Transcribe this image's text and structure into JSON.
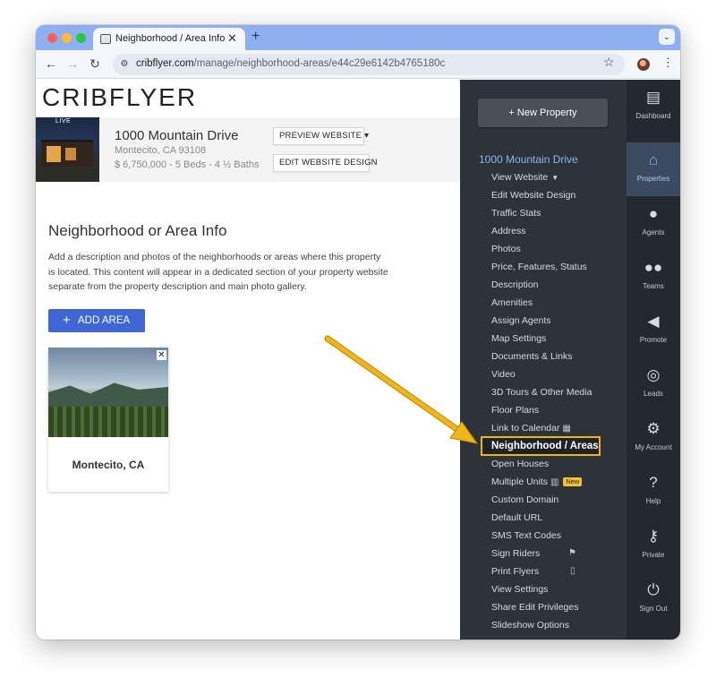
{
  "browser": {
    "tab_title": "Neighborhood / Area Info",
    "url_host": "cribflyer.com",
    "url_path": "/manage/neighborhood-areas/e44c29e6142b4765180c"
  },
  "page": {
    "logo": "CRIBFLYER",
    "property": {
      "live_badge": "LIVE",
      "address": "1000 Mountain Drive",
      "city": "Montecito, CA 93108",
      "stats": "$ 6,750,000 - 5 Beds - 4 ½ Baths",
      "preview_label": "PREVIEW WEBSITE",
      "edit_label": "EDIT WEBSITE DESIGN"
    },
    "heading": "Neighborhood or Area Info",
    "description": "Add a description and photos of the neighborhoods or areas where this property is located. This content will appear in a dedicated section of your property website separate from the property description and main photo gallery.",
    "add_area_label": "ADD AREA",
    "areas": [
      {
        "title": "Montecito, CA"
      }
    ]
  },
  "menu": {
    "new_property_label": "New Property",
    "property_title": "1000 Mountain Drive",
    "items": [
      "View Website",
      "Edit Website Design",
      "Traffic Stats",
      "Address",
      "Photos",
      "Price, Features, Status",
      "Description",
      "Amenities",
      "Assign Agents",
      "Map Settings",
      "Documents & Links",
      "Video",
      "3D Tours & Other Media",
      "Floor Plans",
      "Link to Calendar",
      "Neighborhood / Areas",
      "Open Houses",
      "Multiple Units",
      "Custom Domain",
      "Default URL",
      "SMS Text Codes",
      "Sign Riders",
      "Print Flyers",
      "View Settings",
      "Share Edit Privileges",
      "Slideshow Options"
    ],
    "new_badge": "New"
  },
  "rail": [
    {
      "label": "Dashboard",
      "icon": "dashboard-icon"
    },
    {
      "label": "Properties",
      "icon": "properties-icon"
    },
    {
      "label": "Agents",
      "icon": "agent-icon"
    },
    {
      "label": "Teams",
      "icon": "teams-icon"
    },
    {
      "label": "Promote",
      "icon": "megaphone-icon"
    },
    {
      "label": "Leads",
      "icon": "target-icon"
    },
    {
      "label": "My Account",
      "icon": "gear-icon"
    },
    {
      "label": "Help",
      "icon": "help-icon"
    },
    {
      "label": "Private",
      "icon": "key-icon"
    },
    {
      "label": "Sign Out",
      "icon": "power-icon"
    }
  ],
  "colors": {
    "highlight": "#f2b516",
    "accent_button": "#3e66d4",
    "menu_bg": "#2e333a",
    "rail_bg": "#24292f"
  }
}
